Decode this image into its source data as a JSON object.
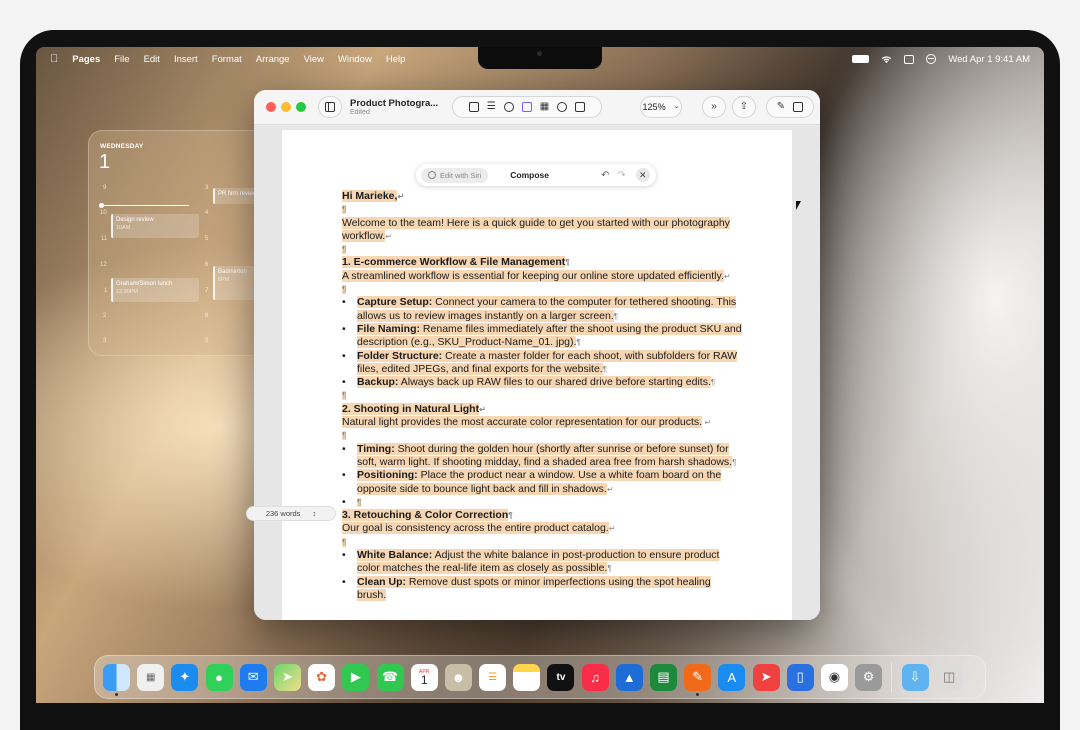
{
  "menubar": {
    "app": "Pages",
    "items": [
      "File",
      "Edit",
      "Insert",
      "Format",
      "Arrange",
      "View",
      "Window",
      "Help"
    ],
    "clock": "Wed Apr 1  9:41 AM"
  },
  "calendar": {
    "weekday": "WEDNESDAY",
    "day": "1",
    "hours_left": [
      "9",
      "10",
      "11",
      "12",
      "1",
      "2",
      "3"
    ],
    "hours_right": [
      "3",
      "4",
      "5",
      "6",
      "7",
      "8",
      "9"
    ],
    "events": [
      {
        "title": "PR firm review",
        "time": ""
      },
      {
        "title": "Design review",
        "time": "10AM"
      },
      {
        "title": "Graham/Simon lunch",
        "time": "12:30PM"
      },
      {
        "title": "Badminton",
        "time": "6PM"
      }
    ]
  },
  "window": {
    "title": "Product Photogra...",
    "subtitle": "Edited",
    "zoom": "125%"
  },
  "writing_tools": {
    "edit_with_siri": "Edit with Siri",
    "compose": "Compose"
  },
  "document": {
    "greeting": "Hi Marieke,",
    "intro": "Welcome to the team! Here is a quick guide to get you started with our photography workflow.",
    "sections": [
      {
        "heading": "1. E-commerce Workflow & File Management",
        "text": "A streamlined workflow is essential for keeping our online store updated efficiently.",
        "bullets": [
          {
            "label": "Capture Setup:",
            "text": " Connect your camera to the computer for tethered shooting. This allows us to review images instantly on a larger screen."
          },
          {
            "label": "File Naming:",
            "text": " Rename files immediately after the shoot using the product SKU and description (e.g., SKU_Product-Name_01. jpg)."
          },
          {
            "label": "Folder Structure:",
            "text": " Create a master folder for each shoot, with subfolders for RAW files, edited JPEGs, and final exports for the website."
          },
          {
            "label": "Backup:",
            "text": " Always back up RAW files to our shared drive before starting edits."
          }
        ]
      },
      {
        "heading": "2. Shooting in Natural Light",
        "text": "Natural light provides the most accurate color representation for our products.",
        "bullets": [
          {
            "label": "Timing:",
            "text": " Shoot during the golden hour (shortly after sunrise or before sunset) for soft, warm light. If shooting midday, find a shaded area free from harsh shadows."
          },
          {
            "label": "Positioning:",
            "text": " Place the product near a window. Use a white foam board on the opposite side to bounce light back and fill in shadows."
          }
        ]
      },
      {
        "heading": "3. Retouching & Color Correction",
        "text": "Our goal is consistency across the entire product catalog.",
        "bullets": [
          {
            "label": "White Balance:",
            "text": " Adjust the white balance in post-production to ensure product color matches the real-life item as closely as possible."
          },
          {
            "label": "Clean Up:",
            "text": " Remove dust spots or minor imperfections using the spot healing brush."
          }
        ]
      }
    ]
  },
  "wordcount": "236 words",
  "dock": {
    "icons": [
      "finder-icon",
      "launchpad-icon",
      "safari-icon",
      "messages-icon",
      "mail-icon",
      "maps-icon",
      "photos-icon",
      "facetime-icon",
      "phone-icon",
      "calendar-icon",
      "contacts-icon",
      "reminders-icon",
      "notes-icon",
      "tv-icon",
      "music-icon",
      "keynote-icon",
      "numbers-icon",
      "pages-icon",
      "app-store-icon",
      "rocket-icon",
      "iphone-mirroring-icon",
      "siri-icon",
      "system-settings-icon",
      "downloads-folder-icon",
      "trash-icon"
    ],
    "calendar_month": "APR",
    "calendar_day": "1",
    "tv_label": "tv"
  }
}
